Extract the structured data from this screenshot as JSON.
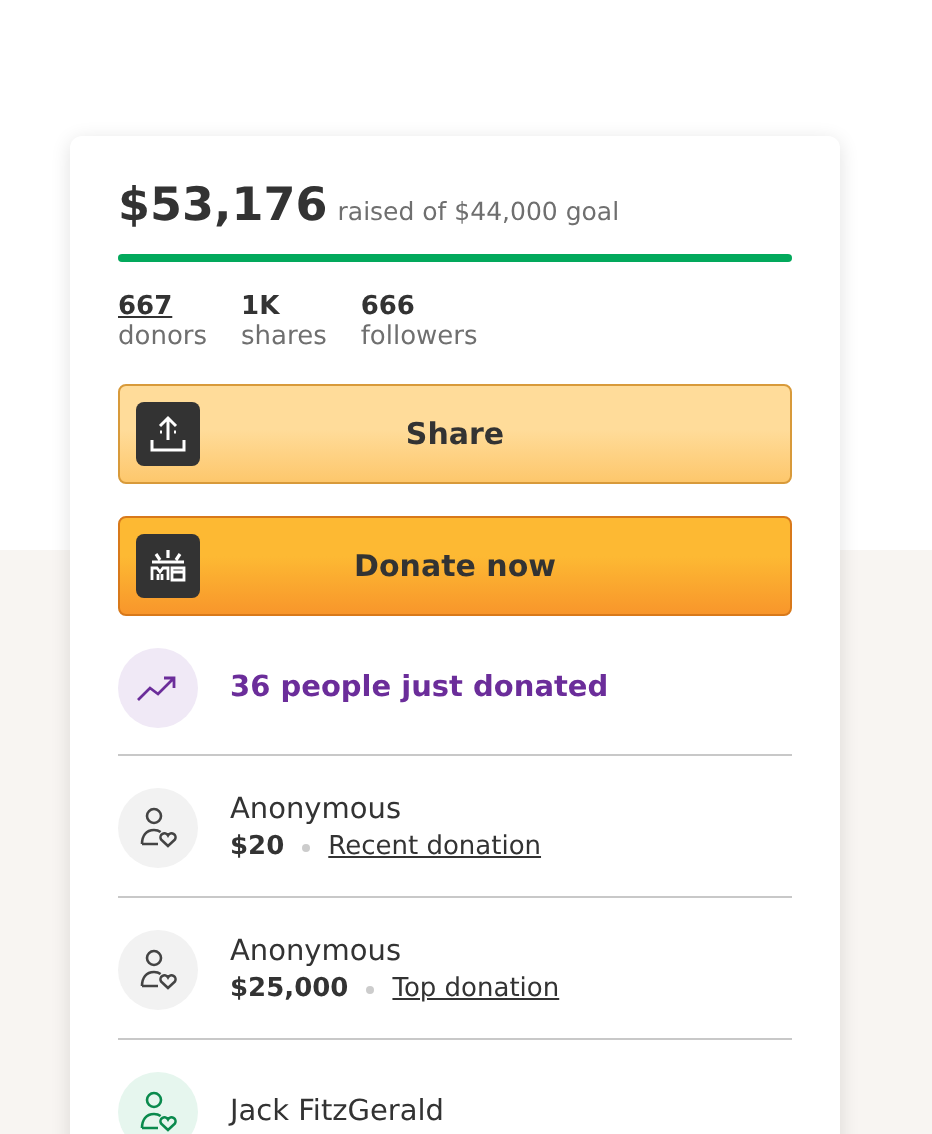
{
  "progress": {
    "raised": "$53,176",
    "goal_text": "raised of $44,000 goal",
    "level": 1
  },
  "stats": [
    {
      "value": "667",
      "label": "donors",
      "linked": true
    },
    {
      "value": "1K",
      "label": "shares",
      "linked": false
    },
    {
      "value": "666",
      "label": "followers",
      "linked": false
    }
  ],
  "buttons": [
    {
      "kind": "share",
      "label": "Share"
    },
    {
      "kind": "donate",
      "label": "Donate now"
    }
  ],
  "trending": {
    "text": "36 people just donated"
  },
  "donations": [
    {
      "name": "Anonymous",
      "amount": "$20",
      "tag": "Recent donation",
      "color": "#f2f2f2"
    },
    {
      "name": "Anonymous",
      "amount": "$25,000",
      "tag": "Top donation",
      "color": "#f2f2f2"
    },
    {
      "name": "Jack FitzGerald",
      "color": "#e6f6ee"
    }
  ]
}
